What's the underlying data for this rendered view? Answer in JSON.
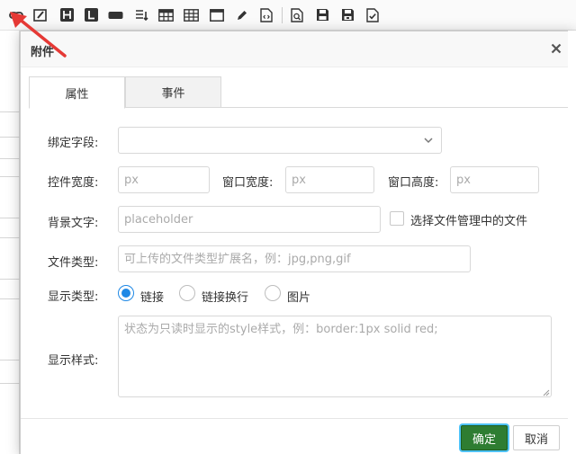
{
  "toolbar": {
    "icons": [
      "link-icon",
      "edit-box-icon",
      "heading-h-icon",
      "label-l-icon",
      "input-bar-icon",
      "list-icon",
      "table-icon",
      "grid-icon",
      "window-icon",
      "pen-icon",
      "code-file-icon",
      "preview-icon",
      "save-icon",
      "save-as-icon",
      "check-doc-icon"
    ]
  },
  "dialog": {
    "title": "附件",
    "close_icon": "close-icon"
  },
  "tabs": [
    {
      "label": "属性",
      "active": true
    },
    {
      "label": "事件",
      "active": false
    }
  ],
  "form": {
    "bind_field_label": "绑定字段:",
    "bind_field_value": "",
    "control_width_label": "控件宽度:",
    "control_width_placeholder": "px",
    "window_width_label": "窗口宽度:",
    "window_width_placeholder": "px",
    "window_height_label": "窗口高度:",
    "window_height_placeholder": "px",
    "bg_text_label": "背景文字:",
    "bg_text_placeholder": "placeholder",
    "select_file_label": "选择文件管理中的文件",
    "file_type_label": "文件类型:",
    "file_type_placeholder": "可上传的文件类型扩展名，例：jpg,png,gif",
    "display_type_label": "显示类型:",
    "display_options": [
      {
        "label": "链接",
        "selected": true
      },
      {
        "label": "链接换行",
        "selected": false
      },
      {
        "label": "图片",
        "selected": false
      }
    ],
    "display_style_label": "显示样式:",
    "display_style_placeholder": "状态为只读时显示的style样式，例：border:1px solid red;"
  },
  "footer": {
    "ok_label": "确定",
    "cancel_label": "取消"
  },
  "colors": {
    "accent": "#1e88e5",
    "ok_button": "#2e7d32",
    "annotation_arrow": "#e53935"
  }
}
